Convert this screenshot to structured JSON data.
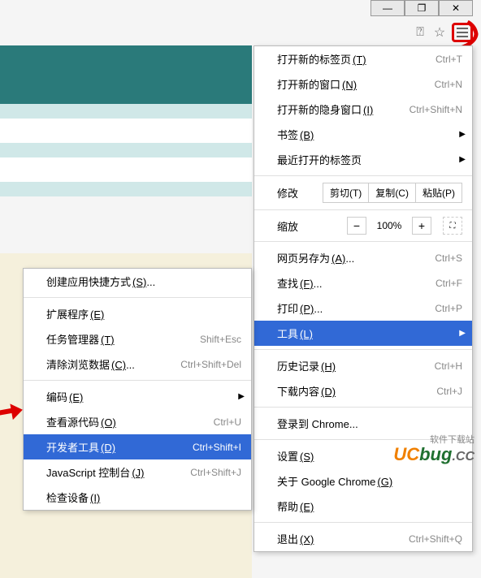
{
  "windowControls": {
    "min": "—",
    "max": "❐",
    "close": "✕"
  },
  "mainMenu": {
    "newTab": {
      "label": "打开新的标签页",
      "m": "(T)",
      "shortcut": "Ctrl+T"
    },
    "newWindow": {
      "label": "打开新的窗口",
      "m": "(N)",
      "shortcut": "Ctrl+N"
    },
    "incognito": {
      "label": "打开新的隐身窗口",
      "m": "(I)",
      "shortcut": "Ctrl+Shift+N"
    },
    "bookmarks": {
      "label": "书签",
      "m": "(B)"
    },
    "recentTabs": {
      "label": "最近打开的标签页"
    },
    "edit": {
      "label": "修改",
      "cut": "剪切",
      "cutM": "(T)",
      "copy": "复制",
      "copyM": "(C)",
      "paste": "粘贴",
      "pasteM": "(P)"
    },
    "zoom": {
      "label": "缩放",
      "minus": "−",
      "value": "100%",
      "plus": "+"
    },
    "saveAs": {
      "label": "网页另存为",
      "m": "(A)",
      "shortcut": "Ctrl+S"
    },
    "find": {
      "label": "查找",
      "m": "(F)",
      "shortcut": "Ctrl+F"
    },
    "print": {
      "label": "打印",
      "m": "(P)",
      "shortcut": "Ctrl+P"
    },
    "tools": {
      "label": "工具",
      "m": "(L)"
    },
    "history": {
      "label": "历史记录",
      "m": "(H)",
      "shortcut": "Ctrl+H"
    },
    "downloads": {
      "label": "下载内容",
      "m": "(D)",
      "shortcut": "Ctrl+J"
    },
    "signin": {
      "label": "登录到 Chrome..."
    },
    "settings": {
      "label": "设置",
      "m": "(S)"
    },
    "about": {
      "label": "关于 Google Chrome",
      "m": "(G)"
    },
    "help": {
      "label": "帮助",
      "m": "(E)"
    },
    "exit": {
      "label": "退出",
      "m": "(X)",
      "shortcut": "Ctrl+Shift+Q"
    }
  },
  "subMenu": {
    "createShortcut": {
      "label": "创建应用快捷方式",
      "m": "(S)",
      "suffix": "..."
    },
    "extensions": {
      "label": "扩展程序",
      "m": "(E)"
    },
    "taskManager": {
      "label": "任务管理器",
      "m": "(T)",
      "shortcut": "Shift+Esc"
    },
    "clearData": {
      "label": "清除浏览数据",
      "m": "(C)",
      "suffix": "...",
      "shortcut": "Ctrl+Shift+Del"
    },
    "encoding": {
      "label": "编码",
      "m": "(E)"
    },
    "viewSource": {
      "label": "查看源代码",
      "m": "(O)",
      "shortcut": "Ctrl+U"
    },
    "devTools": {
      "label": "开发者工具",
      "m": "(D)",
      "shortcut": "Ctrl+Shift+I"
    },
    "jsConsole": {
      "label": "JavaScript 控制台",
      "m": "(J)",
      "shortcut": "Ctrl+Shift+J"
    },
    "inspect": {
      "label": "检查设备",
      "m": "(I)"
    }
  },
  "watermark": {
    "tag": "软件下载站",
    "uc": "UC",
    "bug": "bug",
    "cc": ".CC"
  }
}
